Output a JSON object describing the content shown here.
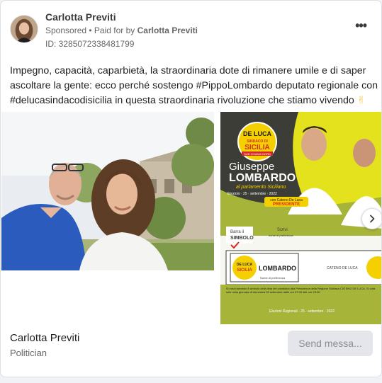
{
  "advertiser": {
    "name": "Carlotta Previti",
    "sponsored_label": "Sponsored",
    "separator": " • ",
    "paid_for_prefix": "Paid for by ",
    "paid_for_name": "Carlotta Previti",
    "ad_id": "ID: 3285072338481799"
  },
  "menu": {
    "icon": "more-horizontal-icon",
    "glyph": "•••"
  },
  "post": {
    "text": "Impegno, capacità, caparbietà, la straordinaria dote di rimanere umile e di saper ascoltare la gente: ecco perché sostengo #PippoLombardo deputato regionale con #delucasindacodisicilia in questa straordinaria rivoluzione che stiamo vivendo",
    "emoji": "✌"
  },
  "carousel": {
    "poster": {
      "logo_top": "DE LUCA",
      "logo_mid": "SINDACO DI",
      "logo_bottom": "SICILIA",
      "logo_strip": "SUD CHIAMA NORD",
      "candidate_first": "Giuseppe",
      "candidate_last": "LOMBARDO",
      "tagline": "al parlamento Siciliano",
      "election_line": "Elezioni · 25 · settembre · 2022",
      "badge_line1": "con Cateno De Luca",
      "badge_line2": "PRESIDENTE",
      "instr_barra": "Barra il",
      "instr_simbolo": "SIMBOLO",
      "instr_scrivi": "Scrivi",
      "instr_scrivi_sub": "nome di preferenza",
      "ballot_name": "LOMBARDO",
      "ballot_sub": "Nome di preferenza",
      "ballot_right": "CATENO DE LUCA",
      "footer_note": "Si vota barrando il simbolo della lista del candidato alla Presidenza della Regione Siciliana CATENO DE LUCA. Si vota solo nella giornata di domenica 25 settembre dalle ore 07:00 alle ore 23:00",
      "footer_date": "Elezioni Regionali · 25 · settembre · 2022"
    },
    "next_icon": "chevron-right-icon"
  },
  "footer": {
    "page_name": "Carlotta Previti",
    "page_category": "Politician",
    "send_label": "Send messa..."
  },
  "colors": {
    "poster_green": "#a6b43a",
    "poster_dark": "#3b3d36",
    "logo_yellow": "#f5d000",
    "logo_red": "#d52a22",
    "sky": "#dfe6ee"
  }
}
